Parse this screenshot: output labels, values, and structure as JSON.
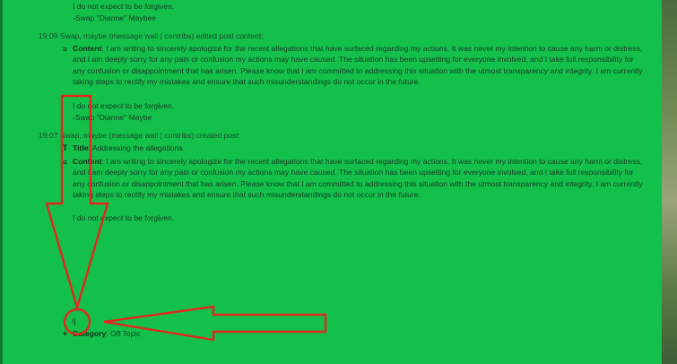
{
  "top": {
    "line1": "I do not expect to be forgiven.",
    "line2": "-Swap \"Dianne\" Maybee"
  },
  "entries": [
    {
      "time": "19:09",
      "summary": "Swap, maybe (message wall | contribs) edited post content:",
      "content_label": "Content",
      "content_text": ": I am writing to sincerely apologize for the recent allegations that have surfaced regarding my actions. It was never my intention to cause any harm or distress, and I am deeply sorry for any pain or confusion my actions may have caused. The situation has been upsetting for everyone involved, and I take full responsibility for any confusion or disappointment that has arisen. Please know that I am committed to addressing this situation with the utmost transparency and integrity. I am currently taking steps to rectify my mistakes and ensure that such misunderstandings do not occur in the future.",
      "sig1": "I do not expect to be forgiven.",
      "sig2": "-Swap \"Dianne\" Maybe"
    },
    {
      "time": "19:07",
      "summary": "Swap, maybe (message wall | contribs) created post:",
      "title_label": "Title",
      "title_text": ": Addressing the allegations",
      "content_label": "Content",
      "content_text": ": I am writing to sincerely apologize for the recent allegations that have surfaced regarding my actions. It was never my intention to cause any harm or distress, and I am deeply sorry for any pain or confusion my actions may have caused. The situation has been upsetting for everyone involved, and I take full responsibility for any confusion or disappointment that has arisen. Please know that I am committed to addressing this situation with the utmost transparency and integrity. I am currently taking steps to rectify my mistakes and ensure that such misunderstandings do not occur in the future.",
      "sig1": "I do not expect to be forgiven.",
      "circled_char": "/j",
      "category_label": "Category",
      "category_text": ": Off Topic"
    }
  ],
  "icons": {
    "content": "lines-icon",
    "title": "text-icon",
    "category": "plus-icon"
  },
  "colors": {
    "background": "#12c04b",
    "annotation": "#e3261f"
  }
}
